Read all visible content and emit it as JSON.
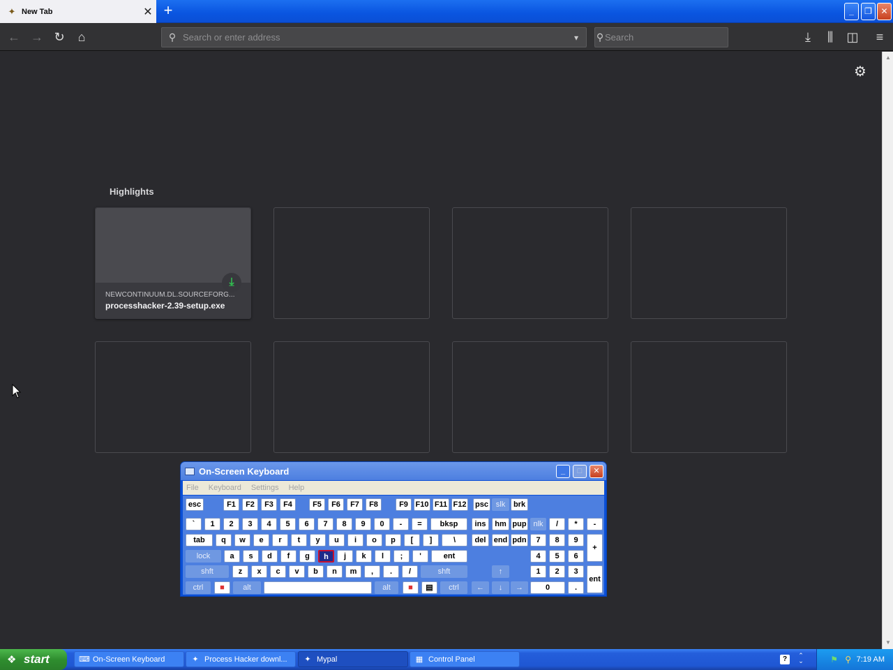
{
  "browser": {
    "tab_title": "New Tab",
    "url_placeholder": "Search or enter address",
    "search_placeholder": "Search"
  },
  "highlights": {
    "title": "Highlights",
    "card": {
      "host": "NEWCONTINUUM.DL.SOURCEFORG...",
      "filename": "processhacker-2.39-setup.exe"
    }
  },
  "osk": {
    "title": "On-Screen Keyboard",
    "menu": [
      "File",
      "Keyboard",
      "Settings",
      "Help"
    ],
    "keys": {
      "esc": "esc",
      "f1": "F1",
      "f2": "F2",
      "f3": "F3",
      "f4": "F4",
      "f5": "F5",
      "f6": "F6",
      "f7": "F7",
      "f8": "F8",
      "f9": "F9",
      "f10": "F10",
      "f11": "F11",
      "f12": "F12",
      "psc": "psc",
      "slk": "slk",
      "brk": "brk",
      "backtick": "`",
      "k1": "1",
      "k2": "2",
      "k3": "3",
      "k4": "4",
      "k5": "5",
      "k6": "6",
      "k7": "7",
      "k8": "8",
      "k9": "9",
      "k0": "0",
      "minus": "-",
      "equals": "=",
      "bksp": "bksp",
      "tab": "tab",
      "q": "q",
      "w": "w",
      "e": "e",
      "r": "r",
      "t": "t",
      "y": "y",
      "u": "u",
      "i": "i",
      "o": "o",
      "p": "p",
      "lbracket": "[",
      "rbracket": "]",
      "backslash": "\\",
      "lock": "lock",
      "a": "a",
      "s": "s",
      "d": "d",
      "f": "f",
      "g": "g",
      "h": "h",
      "j": "j",
      "k": "k",
      "l": "l",
      "semicolon": ";",
      "quote": "'",
      "ent": "ent",
      "shft": "shft",
      "z": "z",
      "x": "x",
      "c": "c",
      "v": "v",
      "b": "b",
      "n": "n",
      "m": "m",
      "comma": ",",
      "period": ".",
      "slash": "/",
      "ctrl": "ctrl",
      "alt": "alt",
      "ins": "ins",
      "hm": "hm",
      "pup": "pup",
      "del": "del",
      "end": "end",
      "pdn": "pdn",
      "nlk": "nlk",
      "np_div": "/",
      "np_mul": "*",
      "np_sub": "-",
      "np_add": "+",
      "np_ent": "ent",
      "np_dot": ".",
      "np7": "7",
      "np8": "8",
      "np9": "9",
      "np4": "4",
      "np5": "5",
      "np6": "6",
      "np1": "1",
      "np2": "2",
      "np3": "3",
      "np0": "0"
    }
  },
  "taskbar": {
    "start": "start",
    "tasks": [
      "On-Screen Keyboard",
      "Process Hacker downl...",
      "Mypal",
      "Control Panel"
    ],
    "clock": "7:19 AM"
  },
  "colors": {
    "content_bg": "#2a2a2e",
    "toolbar_bg": "#323234",
    "xp_blue": "#0a55e0",
    "download_green": "#31c150"
  }
}
